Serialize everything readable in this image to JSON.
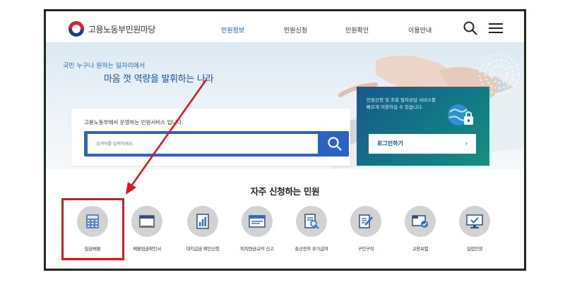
{
  "header": {
    "site_name": "고용노동부민원마당",
    "nav": [
      {
        "label": "민원정보",
        "active": true
      },
      {
        "label": "민원신청",
        "active": false
      },
      {
        "label": "민원확인",
        "active": false
      },
      {
        "label": "이용안내",
        "active": false
      }
    ],
    "icons": [
      "search-icon",
      "hamburger-menu-icon"
    ]
  },
  "hero": {
    "small_text": "국민 누구나 원하는 일자리에서",
    "big_text": "마음 껏 역량을 발휘하는 나라"
  },
  "search": {
    "title": "고용노동부에서 운영하는 민원서비스 입니다.",
    "placeholder": "검색어를 입력하세요."
  },
  "login_panel": {
    "description": "민원신청 및 조회 절차상담 서비스를 빠르게 이용하실 수 있습니다.",
    "button_label": "로그인하기",
    "button_chevron": "›"
  },
  "frequent": {
    "title": "자주 신청하는 민원",
    "items": [
      {
        "label": "임금체불",
        "icon": "calculator-icon"
      },
      {
        "label": "체불임금확인서",
        "icon": "document-window-icon"
      },
      {
        "label": "대지급금 확인신청",
        "icon": "bar-chart-document-icon"
      },
      {
        "label": "퇴직연금규약 신고",
        "icon": "id-card-icon"
      },
      {
        "label": "출산전후 휴가급여",
        "icon": "document-magnifier-icon"
      },
      {
        "label": "구인구직",
        "icon": "pen-document-icon"
      },
      {
        "label": "고용보험",
        "icon": "checked-folder-icon"
      },
      {
        "label": "실업인정",
        "icon": "monitor-check-icon"
      }
    ]
  },
  "annotation": {
    "highlight_color": "#e0141a",
    "highlighted_item": "임금체불"
  },
  "colors": {
    "accent_blue": "#2a63c4",
    "nav_active": "#2056b8",
    "login_teal": "#127a86"
  }
}
